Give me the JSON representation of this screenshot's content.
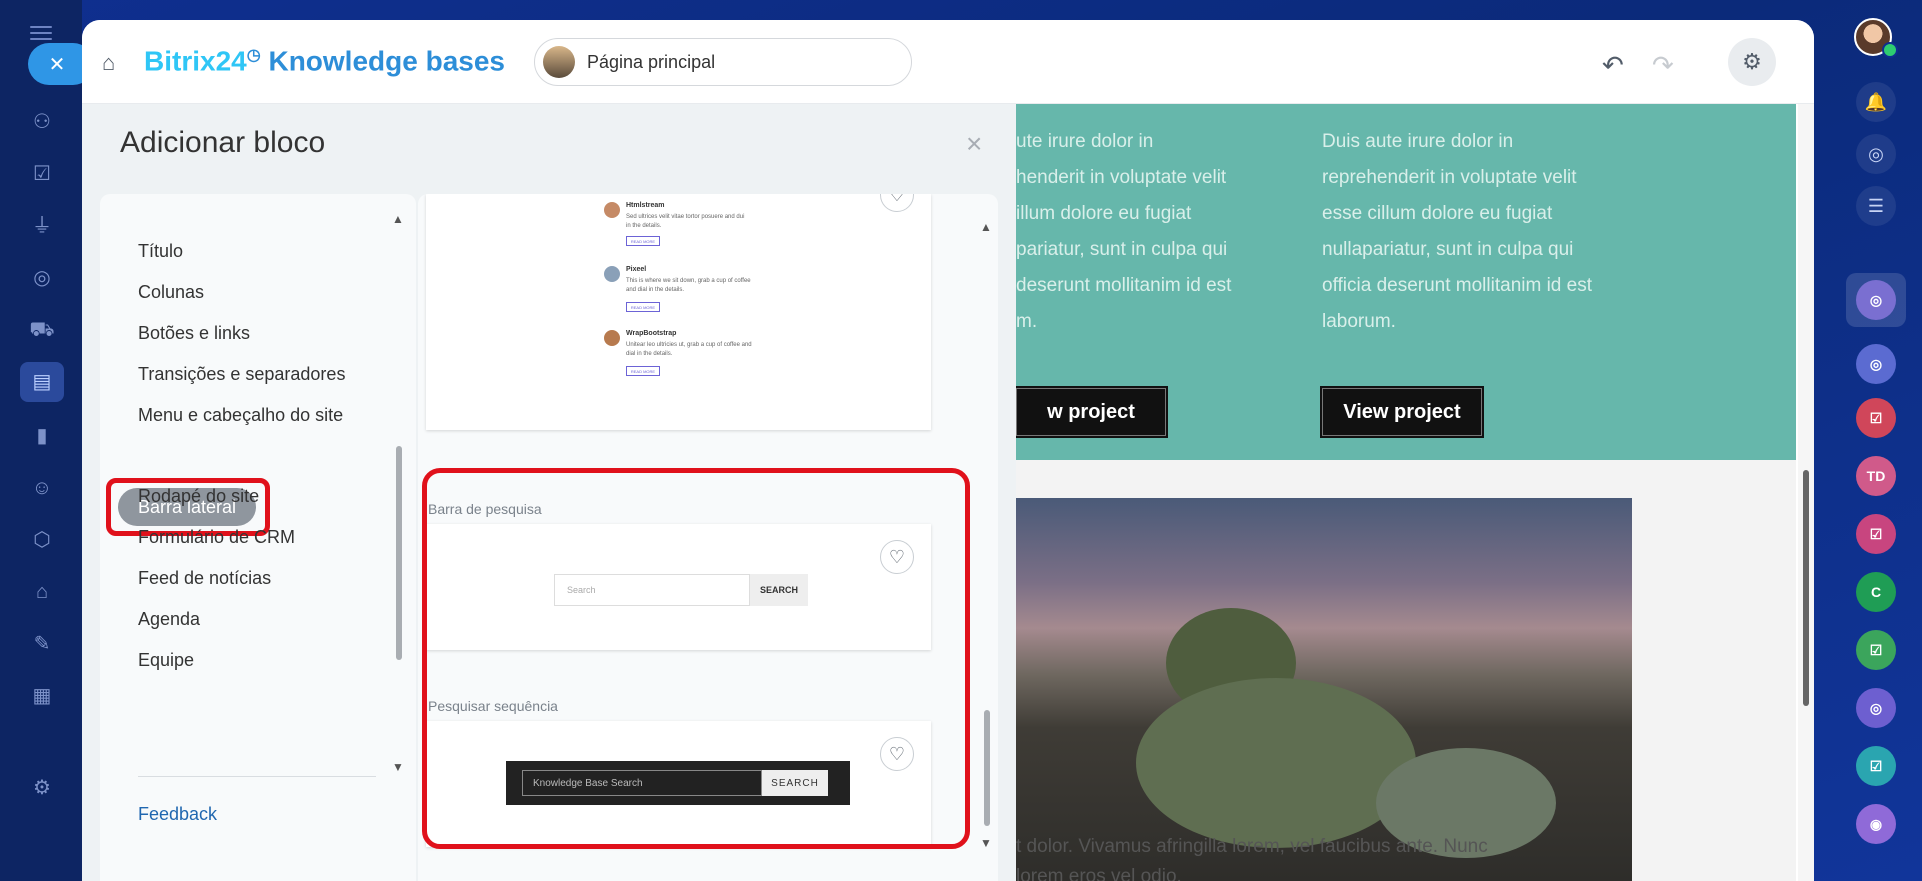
{
  "window": {
    "title_brand": "Bitrix24",
    "title_rest": " Knowledge bases",
    "page_selector": "Página principal"
  },
  "panel": {
    "title": "Adicionar bloco",
    "categories": [
      "Título",
      "Colunas",
      "Botões e links",
      "Transições e separadores",
      "Menu e cabeçalho do site",
      "Barra lateral",
      "Rodapé do site",
      "Formulário de CRM",
      "Feed de notícias",
      "Agenda",
      "Equipe"
    ],
    "active_category": "Barra lateral",
    "feedback_label": "Feedback"
  },
  "blocks": {
    "blog_preview": {
      "entries": [
        {
          "name": "Htmlstream",
          "line1": "Sed ultrices velit vitae tortor posuere and dui",
          "line2": "in the details.",
          "button": "READ MORE"
        },
        {
          "name": "Pixeel",
          "line1": "This is where we sit down, grab a cup of coffee",
          "line2": "and dial in the details.",
          "button": "READ MORE"
        },
        {
          "name": "WrapBootstrap",
          "line1": "Unitear leo ultricies ut, grab a cup of coffee and",
          "line2": "dial in the details.",
          "button": "READ MORE"
        }
      ]
    },
    "search_bar": {
      "label": "Barra de pesquisa",
      "placeholder": "Search",
      "button": "SEARCH"
    },
    "search_sequence": {
      "label": "Pesquisar sequência",
      "placeholder": "Knowledge Base Search",
      "button": "SEARCH"
    }
  },
  "preview": {
    "col1_text": "ute irure dolor in\nhenderit in voluptate velit\nillum dolore eu fugiat\npariatur, sunt in culpa qui\ndeserunt mollitanim id est\nm.",
    "col2_text": "Duis aute irure dolor in\nreprehenderit in voluptate velit\nesse cillum dolore eu fugiat\nnullapariatur, sunt in culpa qui\nofficia deserunt mollitanim id est\nlaborum.",
    "button1": "w project",
    "button2": "View project",
    "bottom_line1": "t dolor. Vivamus afringilla lorem, vel faucibus ante. Nunc",
    "bottom_line2": "lorem eros vel odio."
  },
  "right_rail": {
    "chips": [
      "TD",
      "C"
    ]
  },
  "colors": {
    "accent": "#2fc6f6",
    "highlight": "#e0111b",
    "teal": "#66b7ab"
  }
}
